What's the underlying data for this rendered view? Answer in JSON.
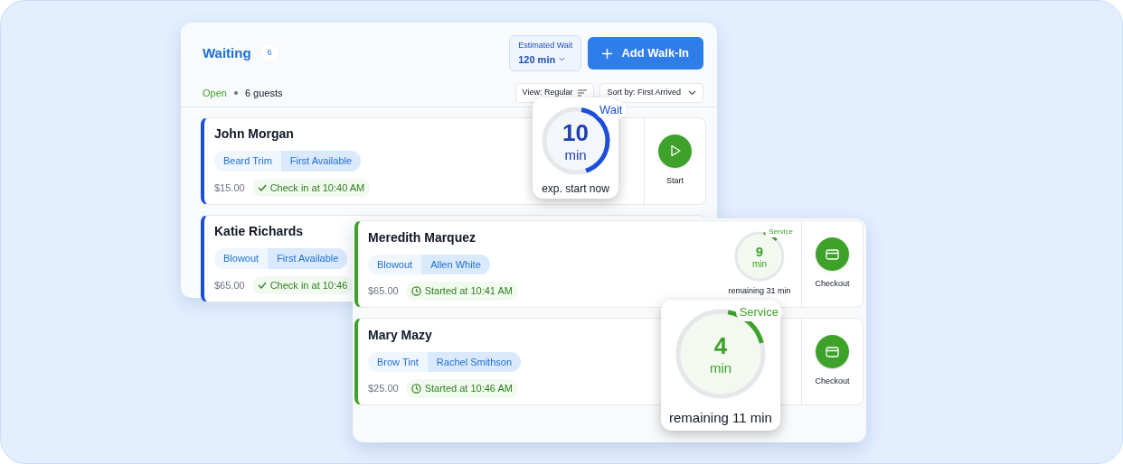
{
  "waiting_panel": {
    "title": "Waiting",
    "count": "6",
    "estimated_wait": {
      "label": "Estimated Wait",
      "value": "120 min"
    },
    "add_button": "Add Walk-In",
    "status": "Open",
    "guests": "6 guests",
    "view": "View: Regular",
    "sort": "Sort by: First Arrived",
    "rows": [
      {
        "name": "John Morgan",
        "service": "Beard Trim",
        "staff": "First Available",
        "price": "$15.00",
        "note": {
          "kind": "checkin",
          "text": "Check in at 10:40 AM"
        },
        "action": {
          "kind": "start",
          "label": "Start"
        }
      },
      {
        "name": "Katie Richards",
        "service": "Blowout",
        "staff": "First Available",
        "price": "$65.00",
        "note": {
          "kind": "checkin",
          "text": "Check in at 10:46"
        }
      }
    ]
  },
  "service_panel": {
    "rows": [
      {
        "name": "Meredith Marquez",
        "service": "Blowout",
        "staff": "Allen White",
        "price": "$65.00",
        "note": {
          "kind": "started",
          "text": "Started at 10:41 AM"
        },
        "timer": {
          "kind": "service",
          "label": "Service",
          "value": "9",
          "unit": "min",
          "caption": "remaining 31 min",
          "level": 0.1
        },
        "action": {
          "kind": "checkout",
          "label": "Checkout"
        }
      },
      {
        "name": "Mary Mazy",
        "service": "Brow Tint",
        "staff": "Rachel Smithson",
        "price": "$25.00",
        "note": {
          "kind": "started",
          "text": "Started at 10:46 AM"
        },
        "action": {
          "kind": "checkout",
          "label": "Checkout"
        }
      }
    ]
  },
  "zoom_popups": [
    {
      "kind": "wait",
      "label": "Wait",
      "value": "10",
      "unit": "min",
      "caption": "exp. start now",
      "level": 0.42
    },
    {
      "kind": "service",
      "label": "Service",
      "value": "4",
      "unit": "min",
      "caption": "remaining 11 min",
      "level": 0.18
    }
  ]
}
